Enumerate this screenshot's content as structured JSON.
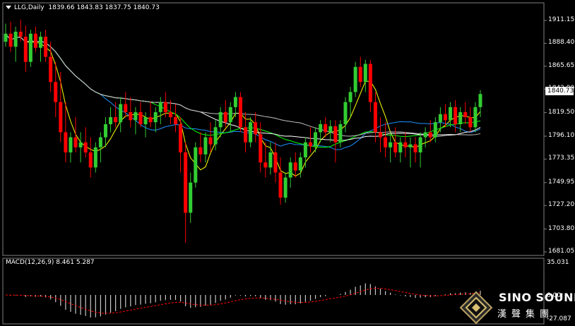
{
  "header": {
    "symbol": "LLG,Daily",
    "ohlc": "1839.66 1843.83 1837.75 1840.73"
  },
  "macd": {
    "label": "MACD(12,26,9) 8.461 5.287",
    "axis": [
      "35.031",
      "0.00",
      "-27.087"
    ]
  },
  "last_price": "1840.73",
  "price_axis": [
    "1911.15",
    "1888.40",
    "1865.65",
    "1842.90",
    "1819.50",
    "1796.10",
    "1773.35",
    "1749.95",
    "1727.20",
    "1703.80",
    "1681.05"
  ],
  "logo": {
    "name": "SINO SOUND",
    "name_cn": "漢聲集團"
  },
  "colors": {
    "bull": "#32CD32",
    "bear": "#FF0000",
    "ma_short": "#FFFF00",
    "ma_mid": "#1E90FF",
    "ma_green": "#00FF00",
    "ma_white": "#FFFFFF",
    "ma_long": "#C0C0C0",
    "signal": "#FF0000"
  },
  "chart_data": {
    "type": "candlestick",
    "y_range": [
      1681.05,
      1911.15
    ],
    "candles": [
      [
        1890,
        1908,
        1885,
        1898
      ],
      [
        1898,
        1910,
        1880,
        1885
      ],
      [
        1885,
        1905,
        1870,
        1900
      ],
      [
        1900,
        1912,
        1890,
        1895
      ],
      [
        1895,
        1906,
        1860,
        1870
      ],
      [
        1870,
        1902,
        1865,
        1898
      ],
      [
        1898,
        1905,
        1880,
        1884
      ],
      [
        1884,
        1900,
        1870,
        1895
      ],
      [
        1895,
        1902,
        1870,
        1875
      ],
      [
        1875,
        1890,
        1840,
        1850
      ],
      [
        1850,
        1870,
        1815,
        1830
      ],
      [
        1830,
        1860,
        1790,
        1800
      ],
      [
        1800,
        1830,
        1770,
        1780
      ],
      [
        1780,
        1800,
        1770,
        1795
      ],
      [
        1795,
        1815,
        1780,
        1785
      ],
      [
        1785,
        1800,
        1770,
        1790
      ],
      [
        1790,
        1805,
        1775,
        1780
      ],
      [
        1780,
        1795,
        1755,
        1765
      ],
      [
        1765,
        1790,
        1760,
        1785
      ],
      [
        1785,
        1800,
        1770,
        1795
      ],
      [
        1795,
        1815,
        1785,
        1808
      ],
      [
        1808,
        1825,
        1800,
        1815
      ],
      [
        1815,
        1830,
        1805,
        1810
      ],
      [
        1810,
        1835,
        1800,
        1828
      ],
      [
        1828,
        1840,
        1815,
        1820
      ],
      [
        1820,
        1835,
        1805,
        1812
      ],
      [
        1812,
        1825,
        1798,
        1820
      ],
      [
        1820,
        1830,
        1805,
        1808
      ],
      [
        1808,
        1820,
        1795,
        1815
      ],
      [
        1815,
        1830,
        1805,
        1810
      ],
      [
        1810,
        1825,
        1800,
        1820
      ],
      [
        1820,
        1835,
        1808,
        1830
      ],
      [
        1830,
        1840,
        1815,
        1820
      ],
      [
        1820,
        1832,
        1808,
        1815
      ],
      [
        1815,
        1828,
        1800,
        1808
      ],
      [
        1808,
        1815,
        1760,
        1780
      ],
      [
        1780,
        1790,
        1690,
        1720
      ],
      [
        1720,
        1760,
        1710,
        1750
      ],
      [
        1750,
        1790,
        1745,
        1785
      ],
      [
        1785,
        1800,
        1770,
        1778
      ],
      [
        1778,
        1800,
        1770,
        1795
      ],
      [
        1795,
        1810,
        1780,
        1788
      ],
      [
        1788,
        1812,
        1782,
        1805
      ],
      [
        1805,
        1825,
        1795,
        1820
      ],
      [
        1820,
        1832,
        1805,
        1810
      ],
      [
        1810,
        1830,
        1800,
        1825
      ],
      [
        1825,
        1840,
        1815,
        1835
      ],
      [
        1835,
        1840,
        1800,
        1805
      ],
      [
        1805,
        1820,
        1780,
        1790
      ],
      [
        1790,
        1815,
        1785,
        1810
      ],
      [
        1810,
        1820,
        1790,
        1798
      ],
      [
        1798,
        1810,
        1760,
        1770
      ],
      [
        1770,
        1790,
        1755,
        1765
      ],
      [
        1765,
        1790,
        1758,
        1780
      ],
      [
        1780,
        1790,
        1750,
        1760
      ],
      [
        1760,
        1775,
        1728,
        1735
      ],
      [
        1735,
        1760,
        1730,
        1755
      ],
      [
        1755,
        1775,
        1745,
        1770
      ],
      [
        1770,
        1780,
        1755,
        1762
      ],
      [
        1762,
        1780,
        1755,
        1775
      ],
      [
        1775,
        1795,
        1765,
        1790
      ],
      [
        1790,
        1805,
        1780,
        1786
      ],
      [
        1786,
        1805,
        1780,
        1800
      ],
      [
        1800,
        1812,
        1790,
        1808
      ],
      [
        1808,
        1815,
        1795,
        1800
      ],
      [
        1800,
        1812,
        1790,
        1806
      ],
      [
        1806,
        1812,
        1770,
        1790
      ],
      [
        1790,
        1812,
        1785,
        1808
      ],
      [
        1808,
        1835,
        1800,
        1830
      ],
      [
        1830,
        1845,
        1815,
        1840
      ],
      [
        1840,
        1870,
        1835,
        1865
      ],
      [
        1865,
        1875,
        1845,
        1850
      ],
      [
        1850,
        1872,
        1840,
        1868
      ],
      [
        1868,
        1872,
        1820,
        1830
      ],
      [
        1830,
        1840,
        1790,
        1800
      ],
      [
        1800,
        1815,
        1780,
        1795
      ],
      [
        1795,
        1810,
        1775,
        1785
      ],
      [
        1785,
        1800,
        1770,
        1790
      ],
      [
        1790,
        1805,
        1775,
        1780
      ],
      [
        1780,
        1795,
        1770,
        1790
      ],
      [
        1790,
        1800,
        1775,
        1785
      ],
      [
        1785,
        1795,
        1765,
        1788
      ],
      [
        1788,
        1795,
        1770,
        1780
      ],
      [
        1780,
        1800,
        1765,
        1795
      ],
      [
        1795,
        1805,
        1785,
        1800
      ],
      [
        1800,
        1812,
        1790,
        1795
      ],
      [
        1795,
        1815,
        1790,
        1810
      ],
      [
        1810,
        1825,
        1800,
        1818
      ],
      [
        1818,
        1828,
        1805,
        1812
      ],
      [
        1812,
        1830,
        1805,
        1825
      ],
      [
        1825,
        1832,
        1800,
        1808
      ],
      [
        1808,
        1825,
        1800,
        1820
      ],
      [
        1820,
        1830,
        1808,
        1815
      ],
      [
        1815,
        1825,
        1800,
        1805
      ],
      [
        1805,
        1830,
        1800,
        1825
      ],
      [
        1825,
        1842,
        1815,
        1838
      ]
    ]
  }
}
